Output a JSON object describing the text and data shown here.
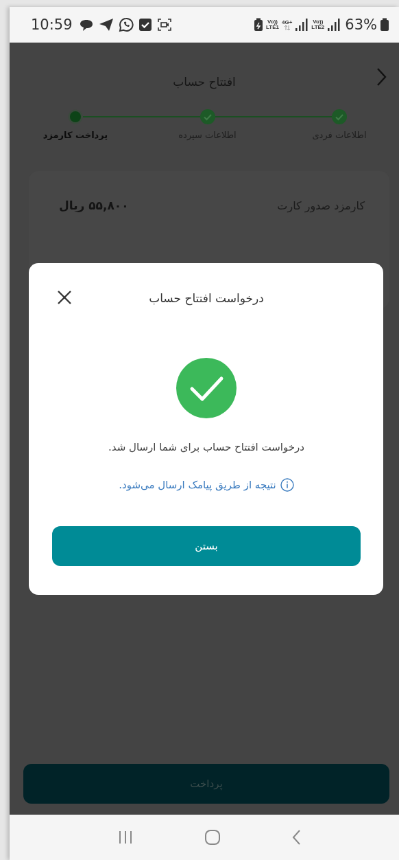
{
  "status_bar": {
    "time": "10:59",
    "sim_1": {
      "top": "Vo))",
      "bottom": "LTE1"
    },
    "data_label": "4G+",
    "sim_2": {
      "top": "Vo))",
      "bottom": "LTE2"
    },
    "battery": "63%"
  },
  "header": {
    "title": "افتتاح حساب"
  },
  "steps": [
    {
      "label": "اطلاعات فردی",
      "completed": true
    },
    {
      "label": "اطلاعات سپرده",
      "completed": true
    },
    {
      "label": "پرداخت کارمزد",
      "completed": false
    }
  ],
  "fees": [
    {
      "label": "کارمزد صدور کارت",
      "amount": "۵۵,۸۰۰ ریال"
    }
  ],
  "pay_button": {
    "label": "پرداخت"
  },
  "dialog": {
    "title": "درخواست افتتاح حساب",
    "succeeded": true,
    "message": "درخواست افتتاح حساب برای شما ارسال شد.",
    "note": "نتیجه از طریق پیامک ارسال می‌شود.",
    "button": "بستن"
  }
}
